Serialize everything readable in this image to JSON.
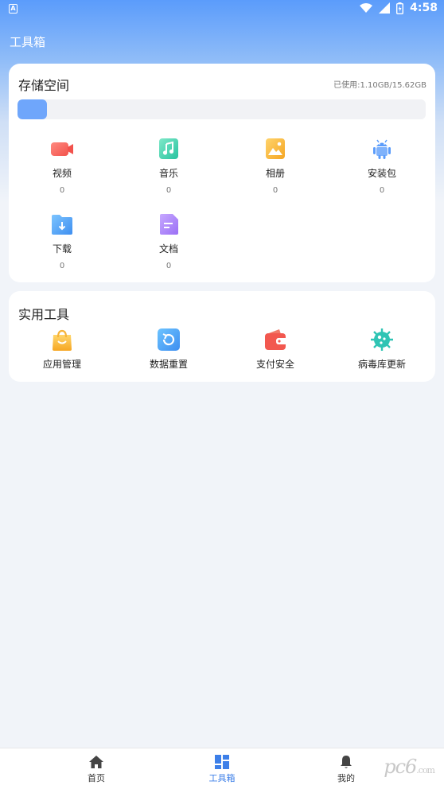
{
  "status_bar": {
    "left_badge": "A",
    "time": "4:58"
  },
  "header": {
    "title": "工具箱"
  },
  "storage": {
    "title": "存储空间",
    "used_text": "已使用:1.10GB/15.62GB",
    "used_fraction": 0.0704,
    "items": [
      {
        "icon": "video-icon",
        "label": "视频",
        "count": "0"
      },
      {
        "icon": "music-icon",
        "label": "音乐",
        "count": "0"
      },
      {
        "icon": "photo-album-icon",
        "label": "相册",
        "count": "0"
      },
      {
        "icon": "android-icon",
        "label": "安装包",
        "count": "0"
      },
      {
        "icon": "download-folder-icon",
        "label": "下载",
        "count": "0"
      },
      {
        "icon": "document-icon",
        "label": "文档",
        "count": "0"
      }
    ]
  },
  "tools": {
    "title": "实用工具",
    "items": [
      {
        "icon": "shopping-bag-icon",
        "label": "应用管理"
      },
      {
        "icon": "reset-icon",
        "label": "数据重置"
      },
      {
        "icon": "wallet-icon",
        "label": "支付安全"
      },
      {
        "icon": "virus-icon",
        "label": "病毒库更新"
      }
    ]
  },
  "bottom_nav": {
    "items": [
      {
        "icon": "home-icon",
        "label": "首页"
      },
      {
        "icon": "toolbox-grid-icon",
        "label": "工具箱",
        "active": true
      },
      {
        "icon": "bell-icon",
        "label": "我的"
      }
    ]
  },
  "watermark": {
    "text": "pc6",
    "suffix": ".com"
  },
  "colors": {
    "accent": "#3d7fe8",
    "progress": "#6fa6fb",
    "header_gradient_top": "#5b9cfb"
  }
}
